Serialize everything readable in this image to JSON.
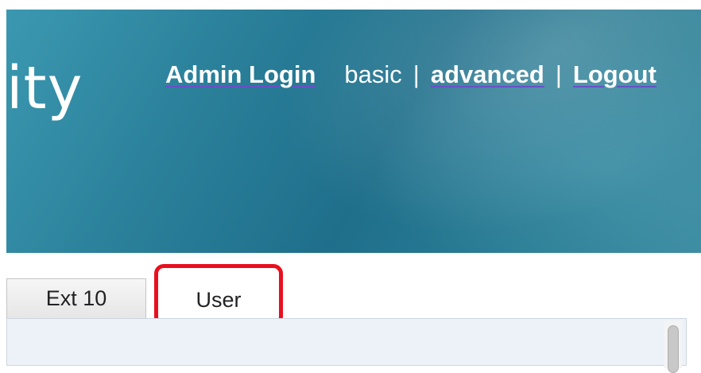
{
  "header": {
    "brand_fragment": "ity",
    "nav": {
      "admin_login": "Admin Login",
      "basic": "basic",
      "separator": "|",
      "advanced": "advanced",
      "logout": "Logout"
    }
  },
  "tabs": [
    {
      "label": "Ext 10"
    },
    {
      "label": "User"
    }
  ],
  "colors": {
    "header_bg": "#2a7f99",
    "highlight_border": "#e8101e",
    "link_underline": "#6b4fc8",
    "content_bg": "#edf2f8"
  }
}
